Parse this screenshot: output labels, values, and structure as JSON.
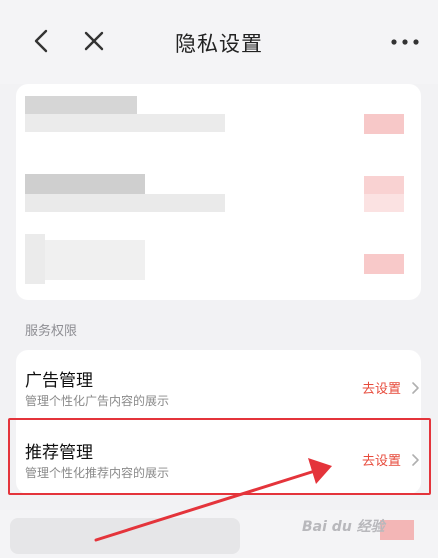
{
  "header": {
    "title": "隐私设置",
    "back_icon": "chevron-left-icon",
    "close_icon": "close-icon",
    "more_icon": "more-horizontal-icon"
  },
  "section": {
    "label": "服务权限"
  },
  "rows": [
    {
      "title": "广告管理",
      "subtitle": "管理个性化广告内容的展示",
      "action": "去设置"
    },
    {
      "title": "推荐管理",
      "subtitle": "管理个性化推荐内容的展示",
      "action": "去设置"
    }
  ],
  "watermark": "Bai du 经验",
  "colors": {
    "accent": "#e74b3c",
    "highlight": "#e4343b",
    "background": "#f2f2f4"
  }
}
